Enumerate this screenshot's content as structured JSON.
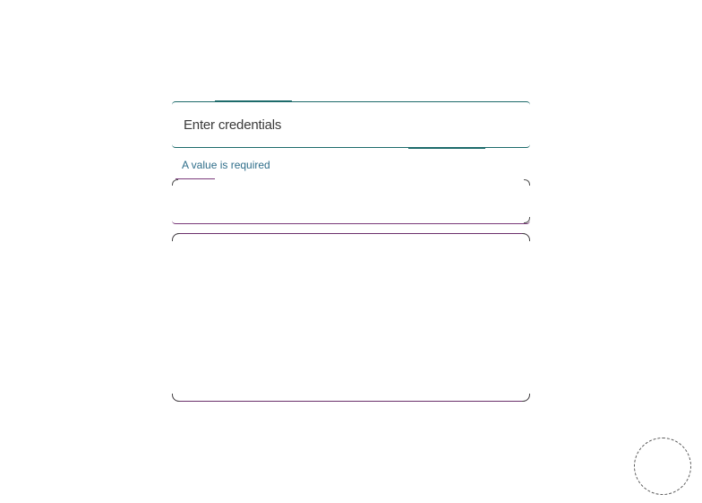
{
  "dialog": {
    "title": "Enter credentials",
    "validation_message": "A value is required",
    "input_value": "",
    "body_text": ""
  },
  "colors": {
    "accent_teal": "#1d6b6b",
    "accent_purple": "#7a3a7a",
    "validation_blue": "#2f6e8a",
    "title_text": "#3a3a3a"
  },
  "icons": {
    "fab": "circle-button-icon"
  }
}
